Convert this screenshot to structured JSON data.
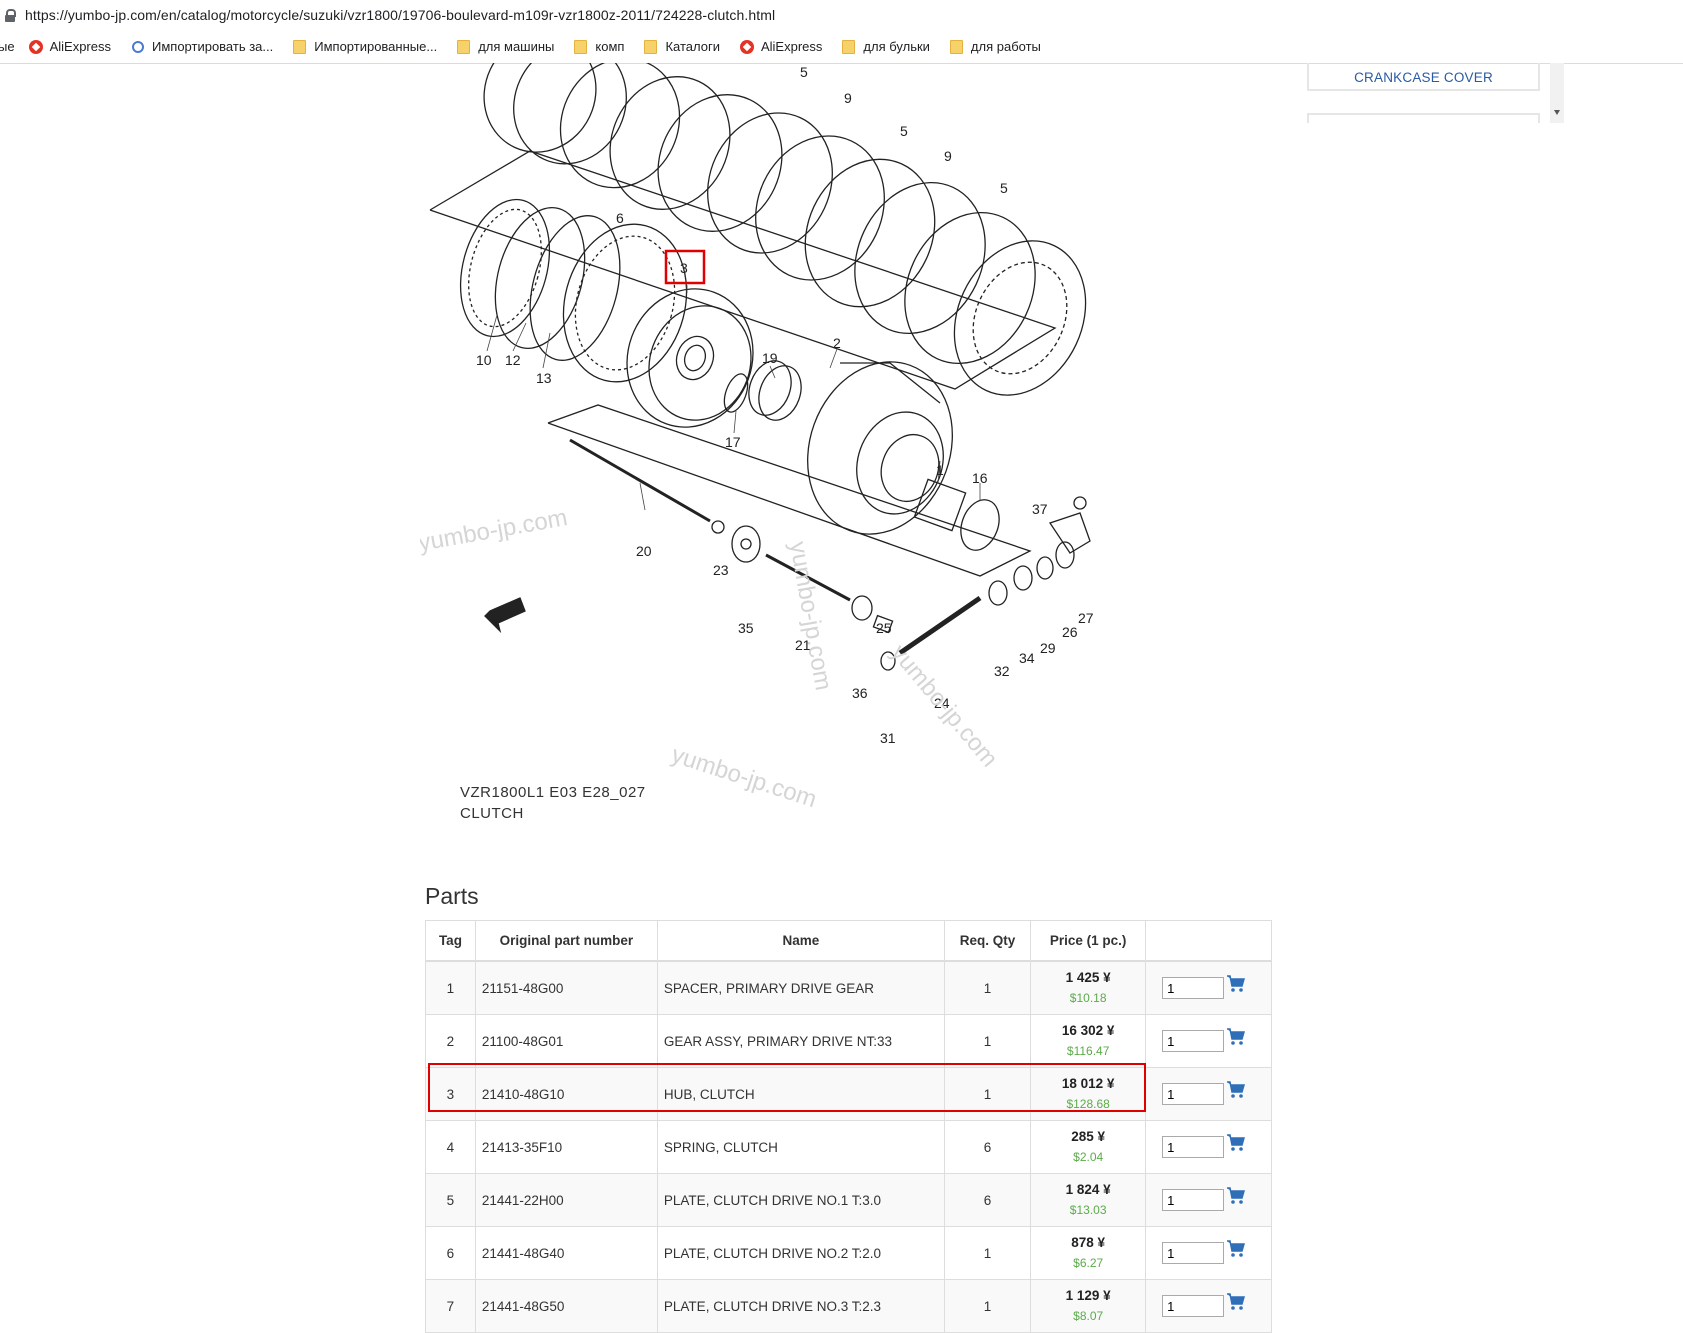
{
  "browser": {
    "url": "https://yumbo-jp.com/en/catalog/motorcycle/suzuki/vzr1800/19706-boulevard-m109r-vzr1800z-2011/724228-clutch.html",
    "bookmarks": [
      {
        "label": "ые",
        "icon": "none"
      },
      {
        "label": "AliExpress",
        "icon": "aliexpress-icon"
      },
      {
        "label": "Импортировать за...",
        "icon": "gear-icon"
      },
      {
        "label": "Импортированные...",
        "icon": "folder-icon"
      },
      {
        "label": "для машины",
        "icon": "folder-icon"
      },
      {
        "label": "комп",
        "icon": "folder-icon"
      },
      {
        "label": "Каталоги",
        "icon": "folder-icon"
      },
      {
        "label": "AliExpress",
        "icon": "aliexpress-icon"
      },
      {
        "label": "для бульки",
        "icon": "folder-icon"
      },
      {
        "label": "для работы",
        "icon": "folder-icon"
      }
    ]
  },
  "sidebar": {
    "card_label": "CRANKCASE COVER"
  },
  "diagram": {
    "caption_line1": "VZR1800L1 E03 E28_027",
    "caption_line2": "CLUTCH",
    "watermark": "yumbo-jp.com",
    "fwd_label": "FWD",
    "highlighted_tag": "3",
    "tags": [
      "1",
      "2",
      "3",
      "5",
      "5",
      "5",
      "6",
      "9",
      "9",
      "10",
      "12",
      "13",
      "16",
      "17",
      "19",
      "20",
      "21",
      "23",
      "24",
      "25",
      "26",
      "27",
      "29",
      "31",
      "32",
      "34",
      "35",
      "36",
      "37"
    ]
  },
  "parts": {
    "title": "Parts",
    "columns": [
      "Tag",
      "Original part number",
      "Name",
      "Req. Qty",
      "Price (1 pc.)",
      ""
    ],
    "rows": [
      {
        "tag": "1",
        "part_number": "21151-48G00",
        "name": "SPACER, PRIMARY DRIVE GEAR",
        "qty": "1",
        "price_yen": "1 425 ¥",
        "price_usd": "$10.18",
        "order_qty": "1"
      },
      {
        "tag": "2",
        "part_number": "21100-48G01",
        "name": "GEAR ASSY, PRIMARY DRIVE NT:33",
        "qty": "1",
        "price_yen": "16 302 ¥",
        "price_usd": "$116.47",
        "order_qty": "1"
      },
      {
        "tag": "3",
        "part_number": "21410-48G10",
        "name": "HUB, CLUTCH",
        "qty": "1",
        "price_yen": "18 012 ¥",
        "price_usd": "$128.68",
        "order_qty": "1"
      },
      {
        "tag": "4",
        "part_number": "21413-35F10",
        "name": "SPRING, CLUTCH",
        "qty": "6",
        "price_yen": "285 ¥",
        "price_usd": "$2.04",
        "order_qty": "1"
      },
      {
        "tag": "5",
        "part_number": "21441-22H00",
        "name": "PLATE, CLUTCH DRIVE NO.1 T:3.0",
        "qty": "6",
        "price_yen": "1 824 ¥",
        "price_usd": "$13.03",
        "order_qty": "1"
      },
      {
        "tag": "6",
        "part_number": "21441-48G40",
        "name": "PLATE, CLUTCH DRIVE NO.2 T:2.0",
        "qty": "1",
        "price_yen": "878 ¥",
        "price_usd": "$6.27",
        "order_qty": "1"
      },
      {
        "tag": "7",
        "part_number": "21441-48G50",
        "name": "PLATE, CLUTCH DRIVE NO.3 T:2.3",
        "qty": "1",
        "price_yen": "1 129 ¥",
        "price_usd": "$8.07",
        "order_qty": "1"
      }
    ]
  },
  "colors": {
    "highlight": "#e00000",
    "link": "#2a5aa3",
    "usd": "#5cab4a",
    "cart": "#2f6fb8"
  }
}
